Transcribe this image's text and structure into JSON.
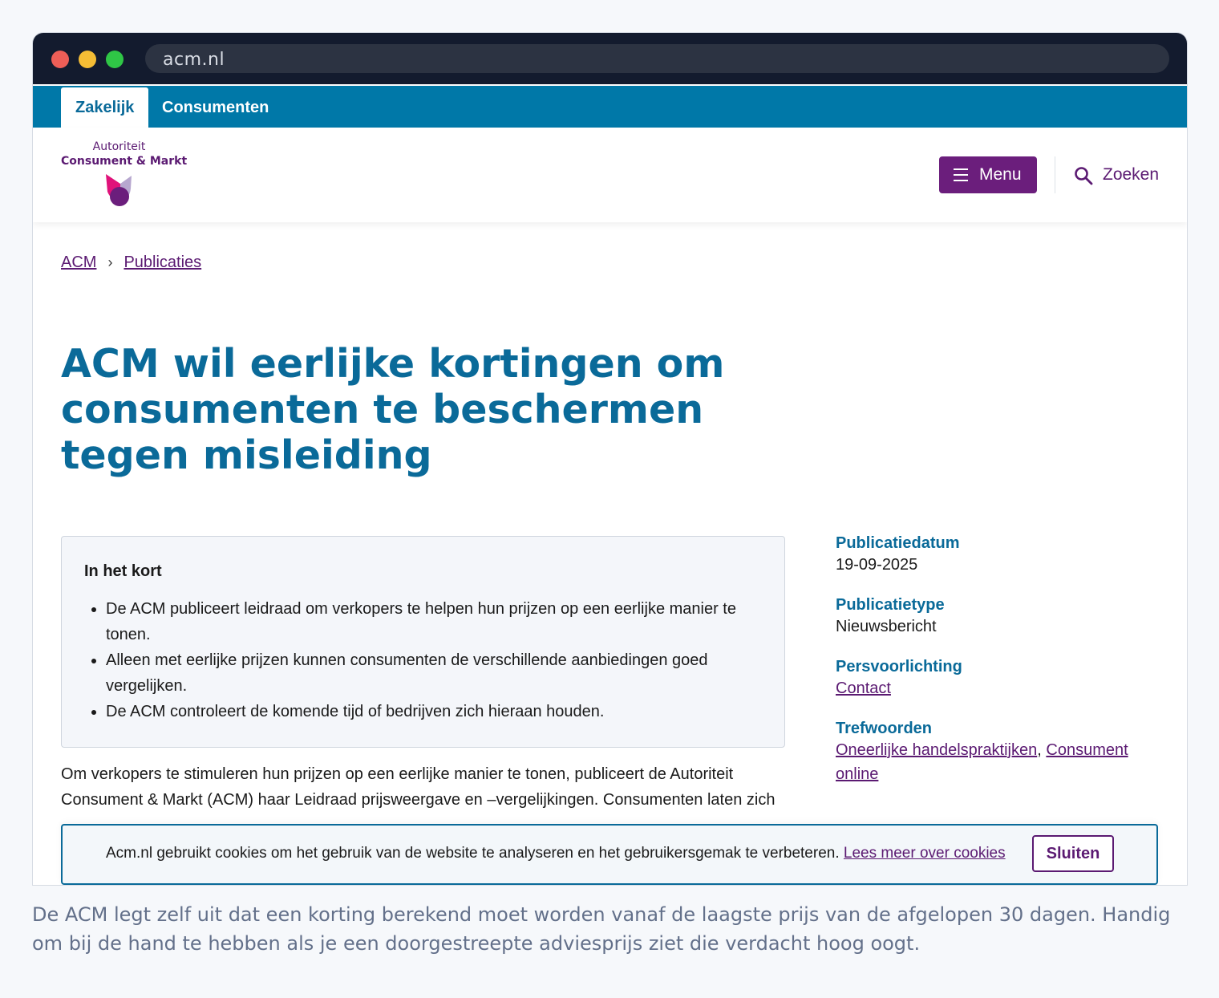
{
  "browser": {
    "url": "acm.nl"
  },
  "topnav": {
    "tabs": [
      {
        "label": "Zakelijk"
      },
      {
        "label": "Consumenten"
      }
    ]
  },
  "logo": {
    "line1": "Autoriteit",
    "line2": "Consument & Markt"
  },
  "header": {
    "menu_label": "Menu",
    "search_label": "Zoeken"
  },
  "breadcrumb": {
    "items": [
      "ACM",
      "Publicaties"
    ]
  },
  "article": {
    "title": "ACM wil eerlijke kortingen om consumenten te beschermen tegen misleiding",
    "summary_heading": "In het kort",
    "summary_items": [
      "De ACM publiceert leidraad om verkopers te helpen hun prijzen op een eerlijke manier te tonen.",
      "Alleen met eerlijke prijzen kunnen consumenten de verschillende aanbiedingen goed vergelijken.",
      "De ACM controleert de komende tijd of bedrijven zich hieraan houden."
    ],
    "body": "Om verkopers te stimuleren hun prijzen op een eerlijke manier te tonen, publiceert de Autoriteit Consument & Markt (ACM) haar Leidraad prijsweergave en –vergelijkingen. Consumenten laten zich"
  },
  "meta": {
    "date_label": "Publicatiedatum",
    "date_value": "19-09-2025",
    "type_label": "Publicatietype",
    "type_value": "Nieuwsbericht",
    "press_label": "Persvoorlichting",
    "press_link": "Contact",
    "keywords_label": "Trefwoorden",
    "keyword_1": "Oneerlijke handelspraktijken",
    "keyword_2": "Consument online"
  },
  "cookie": {
    "message": "Acm.nl gebruikt cookies om het gebruik van de website te analyseren en het gebruikersgemak te verbeteren.",
    "link": "Lees meer over cookies",
    "close": "Sluiten"
  },
  "caption": "De ACM legt zelf uit dat een korting berekend moet worden vanaf de laagste prijs van de afgelopen 30 dagen. Handig om bij de hand te hebben als je een doorgestreepte adviesprijs ziet die verdacht hoog oogt.",
  "colors": {
    "brand_blue": "#0078a8",
    "brand_purple": "#6b1e7c",
    "title_blue": "#0a6a99"
  }
}
